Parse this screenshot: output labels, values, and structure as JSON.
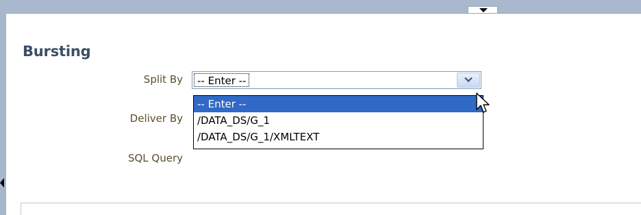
{
  "section": {
    "title": "Bursting"
  },
  "fields": {
    "split_by_label": "Split By",
    "deliver_by_label": "Deliver By",
    "sql_query_label": "SQL Query"
  },
  "split_by_select": {
    "selected_value": "-- Enter --",
    "options": [
      "-- Enter --",
      "/DATA_DS/G_1",
      "/DATA_DS/G_1/XMLTEXT"
    ]
  },
  "icons": {
    "collapse_tab": "chevron-down-icon",
    "select_arrow": "chevron-down-icon",
    "left_handle": "triangle-left-icon",
    "cursor": "mouse-pointer-icon"
  },
  "colors": {
    "title": "#3b4e66",
    "label": "#5a4e2c",
    "selection": "#3169c6",
    "chrome": "#a9b8cc"
  }
}
